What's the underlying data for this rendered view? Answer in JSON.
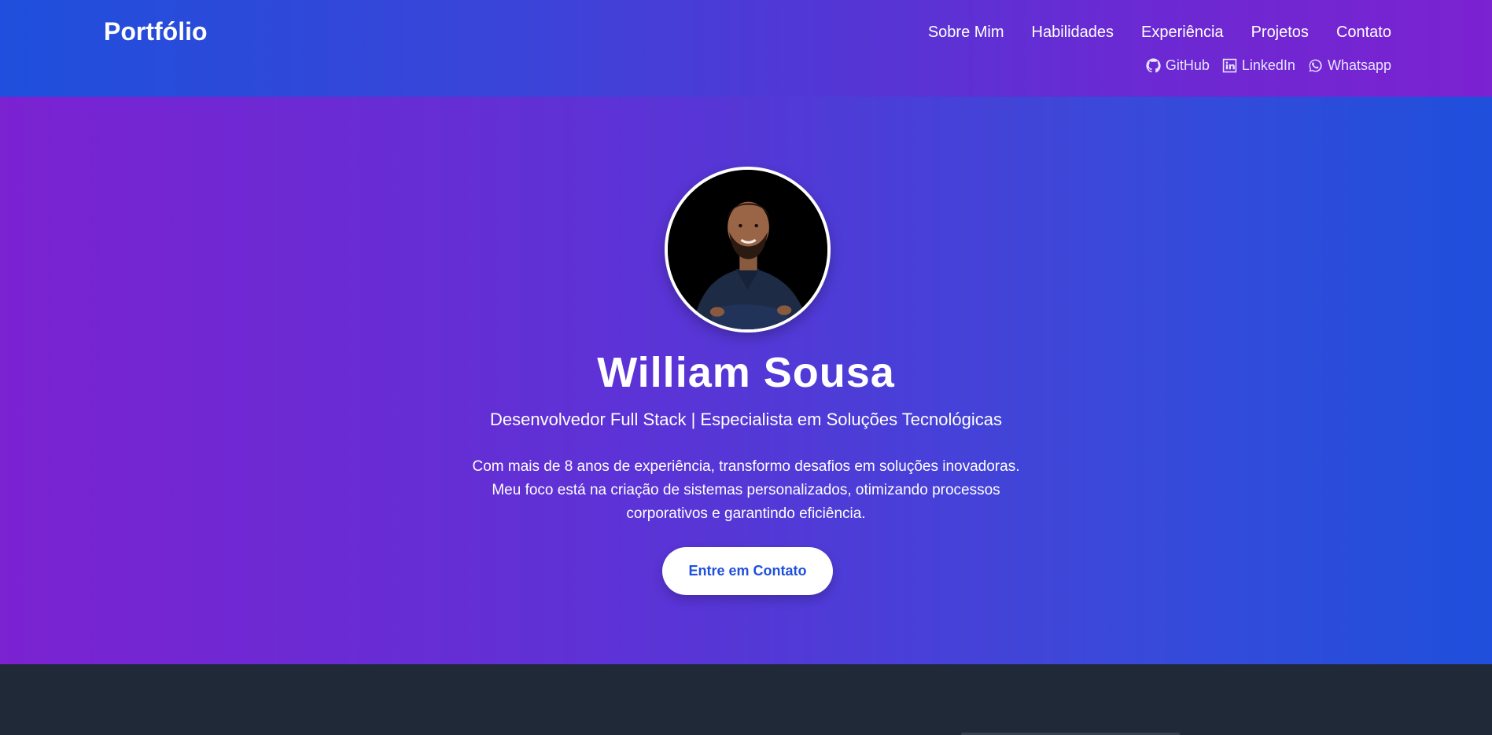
{
  "header": {
    "brand": "Portfólio",
    "nav": [
      {
        "label": "Sobre Mim"
      },
      {
        "label": "Habilidades"
      },
      {
        "label": "Experiência"
      },
      {
        "label": "Projetos"
      },
      {
        "label": "Contato"
      }
    ],
    "social": [
      {
        "label": "GitHub",
        "icon": "github-icon"
      },
      {
        "label": "LinkedIn",
        "icon": "linkedin-icon"
      },
      {
        "label": "Whatsapp",
        "icon": "whatsapp-icon"
      }
    ]
  },
  "hero": {
    "name": "William Sousa",
    "subtitle": "Desenvolvedor Full Stack | Especialista em Soluções Tecnológicas",
    "bio_lines": [
      "Com mais de 8 anos de experiência, transformo desafios em soluções inovadoras.",
      "Meu foco está na criação de sistemas personalizados, otimizando processos",
      "corporativos e garantindo eficiência."
    ],
    "cta_label": "Entre em Contato"
  },
  "colors": {
    "blue": "#1f4fdc",
    "purple": "#7b22d1",
    "dark": "#1f2937",
    "white": "#ffffff"
  }
}
